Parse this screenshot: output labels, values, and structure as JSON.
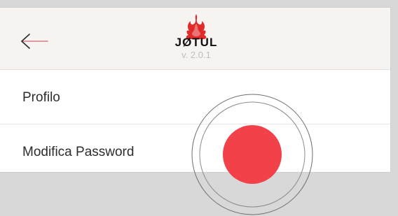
{
  "header": {
    "brand": "JØTUL",
    "version": "v. 2.0.1",
    "back_icon": "back-arrow-icon",
    "logo_icon": "jotul-flame-icon"
  },
  "menu": {
    "items": [
      {
        "label": "Profilo"
      },
      {
        "label": "Modifica Password"
      }
    ]
  },
  "touch_indicator": {
    "color": "#f23d44"
  },
  "colors": {
    "header_bg": "#f7f3f0",
    "accent": "#e12b2b",
    "back_arrow": "#d97a86"
  }
}
